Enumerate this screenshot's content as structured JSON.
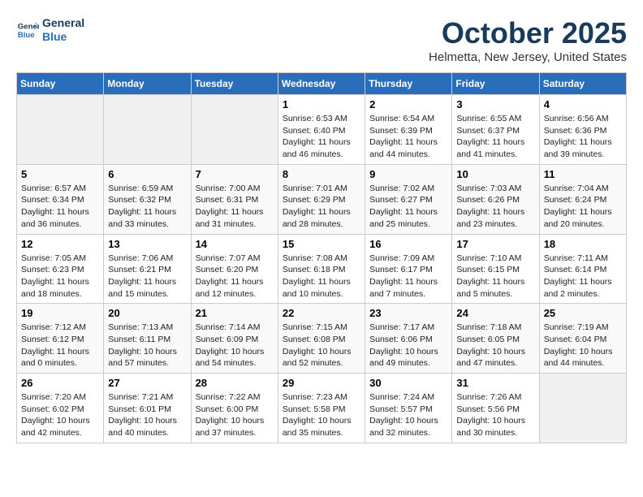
{
  "header": {
    "logo_line1": "General",
    "logo_line2": "Blue",
    "month": "October 2025",
    "location": "Helmetta, New Jersey, United States"
  },
  "weekdays": [
    "Sunday",
    "Monday",
    "Tuesday",
    "Wednesday",
    "Thursday",
    "Friday",
    "Saturday"
  ],
  "weeks": [
    [
      {
        "day": "",
        "info": ""
      },
      {
        "day": "",
        "info": ""
      },
      {
        "day": "",
        "info": ""
      },
      {
        "day": "1",
        "info": "Sunrise: 6:53 AM\nSunset: 6:40 PM\nDaylight: 11 hours\nand 46 minutes."
      },
      {
        "day": "2",
        "info": "Sunrise: 6:54 AM\nSunset: 6:39 PM\nDaylight: 11 hours\nand 44 minutes."
      },
      {
        "day": "3",
        "info": "Sunrise: 6:55 AM\nSunset: 6:37 PM\nDaylight: 11 hours\nand 41 minutes."
      },
      {
        "day": "4",
        "info": "Sunrise: 6:56 AM\nSunset: 6:36 PM\nDaylight: 11 hours\nand 39 minutes."
      }
    ],
    [
      {
        "day": "5",
        "info": "Sunrise: 6:57 AM\nSunset: 6:34 PM\nDaylight: 11 hours\nand 36 minutes."
      },
      {
        "day": "6",
        "info": "Sunrise: 6:59 AM\nSunset: 6:32 PM\nDaylight: 11 hours\nand 33 minutes."
      },
      {
        "day": "7",
        "info": "Sunrise: 7:00 AM\nSunset: 6:31 PM\nDaylight: 11 hours\nand 31 minutes."
      },
      {
        "day": "8",
        "info": "Sunrise: 7:01 AM\nSunset: 6:29 PM\nDaylight: 11 hours\nand 28 minutes."
      },
      {
        "day": "9",
        "info": "Sunrise: 7:02 AM\nSunset: 6:27 PM\nDaylight: 11 hours\nand 25 minutes."
      },
      {
        "day": "10",
        "info": "Sunrise: 7:03 AM\nSunset: 6:26 PM\nDaylight: 11 hours\nand 23 minutes."
      },
      {
        "day": "11",
        "info": "Sunrise: 7:04 AM\nSunset: 6:24 PM\nDaylight: 11 hours\nand 20 minutes."
      }
    ],
    [
      {
        "day": "12",
        "info": "Sunrise: 7:05 AM\nSunset: 6:23 PM\nDaylight: 11 hours\nand 18 minutes."
      },
      {
        "day": "13",
        "info": "Sunrise: 7:06 AM\nSunset: 6:21 PM\nDaylight: 11 hours\nand 15 minutes."
      },
      {
        "day": "14",
        "info": "Sunrise: 7:07 AM\nSunset: 6:20 PM\nDaylight: 11 hours\nand 12 minutes."
      },
      {
        "day": "15",
        "info": "Sunrise: 7:08 AM\nSunset: 6:18 PM\nDaylight: 11 hours\nand 10 minutes."
      },
      {
        "day": "16",
        "info": "Sunrise: 7:09 AM\nSunset: 6:17 PM\nDaylight: 11 hours\nand 7 minutes."
      },
      {
        "day": "17",
        "info": "Sunrise: 7:10 AM\nSunset: 6:15 PM\nDaylight: 11 hours\nand 5 minutes."
      },
      {
        "day": "18",
        "info": "Sunrise: 7:11 AM\nSunset: 6:14 PM\nDaylight: 11 hours\nand 2 minutes."
      }
    ],
    [
      {
        "day": "19",
        "info": "Sunrise: 7:12 AM\nSunset: 6:12 PM\nDaylight: 11 hours\nand 0 minutes."
      },
      {
        "day": "20",
        "info": "Sunrise: 7:13 AM\nSunset: 6:11 PM\nDaylight: 10 hours\nand 57 minutes."
      },
      {
        "day": "21",
        "info": "Sunrise: 7:14 AM\nSunset: 6:09 PM\nDaylight: 10 hours\nand 54 minutes."
      },
      {
        "day": "22",
        "info": "Sunrise: 7:15 AM\nSunset: 6:08 PM\nDaylight: 10 hours\nand 52 minutes."
      },
      {
        "day": "23",
        "info": "Sunrise: 7:17 AM\nSunset: 6:06 PM\nDaylight: 10 hours\nand 49 minutes."
      },
      {
        "day": "24",
        "info": "Sunrise: 7:18 AM\nSunset: 6:05 PM\nDaylight: 10 hours\nand 47 minutes."
      },
      {
        "day": "25",
        "info": "Sunrise: 7:19 AM\nSunset: 6:04 PM\nDaylight: 10 hours\nand 44 minutes."
      }
    ],
    [
      {
        "day": "26",
        "info": "Sunrise: 7:20 AM\nSunset: 6:02 PM\nDaylight: 10 hours\nand 42 minutes."
      },
      {
        "day": "27",
        "info": "Sunrise: 7:21 AM\nSunset: 6:01 PM\nDaylight: 10 hours\nand 40 minutes."
      },
      {
        "day": "28",
        "info": "Sunrise: 7:22 AM\nSunset: 6:00 PM\nDaylight: 10 hours\nand 37 minutes."
      },
      {
        "day": "29",
        "info": "Sunrise: 7:23 AM\nSunset: 5:58 PM\nDaylight: 10 hours\nand 35 minutes."
      },
      {
        "day": "30",
        "info": "Sunrise: 7:24 AM\nSunset: 5:57 PM\nDaylight: 10 hours\nand 32 minutes."
      },
      {
        "day": "31",
        "info": "Sunrise: 7:26 AM\nSunset: 5:56 PM\nDaylight: 10 hours\nand 30 minutes."
      },
      {
        "day": "",
        "info": ""
      }
    ]
  ]
}
